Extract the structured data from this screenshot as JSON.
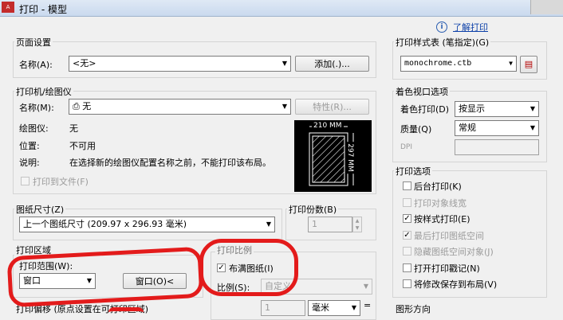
{
  "window": {
    "logo": "A",
    "title": "打印 - 模型"
  },
  "help": {
    "link": "了解打印"
  },
  "page_setup": {
    "title": "页面设置",
    "name_label": "名称(A):",
    "name_value": "<无>",
    "add_button": "添加(.)..."
  },
  "printer": {
    "title": "打印机/绘图仪",
    "name_label": "名称(M):",
    "name_value": "无",
    "properties_button": "特性(R)...",
    "plotter_label": "绘图仪:",
    "plotter_value": "无",
    "location_label": "位置:",
    "location_value": "不可用",
    "description_label": "说明:",
    "description_value": "在选择新的绘图仪配置名称之前，不能打印该布局。",
    "print_to_file": "打印到文件(F)",
    "preview_width": "210 MM",
    "preview_height": "297 MM"
  },
  "paper_size": {
    "title": "图纸尺寸(Z)",
    "value": "上一个图纸尺寸 (209.97 x 296.93 毫米)"
  },
  "copies": {
    "title": "打印份数(B)",
    "value": "1"
  },
  "print_area": {
    "title": "打印区域",
    "range_label": "打印范围(W):",
    "range_value": "窗口",
    "window_button": "窗口(O)<"
  },
  "print_scale": {
    "title": "打印比例",
    "fit_paper": "布满图纸(I)",
    "fit_checked": true,
    "scale_label": "比例(S):",
    "scale_value": "自定义",
    "value1": "1",
    "unit": "毫米",
    "equals": "="
  },
  "print_offset": {
    "title": "打印偏移 (原点设置在可打印区域)"
  },
  "plot_style": {
    "title": "打印样式表 (笔指定)(G)",
    "value": "monochrome.ctb"
  },
  "shaded_viewport": {
    "title": "着色视口选项",
    "shade_label": "着色打印(D)",
    "shade_value": "按显示",
    "quality_label": "质量(Q)",
    "quality_value": "常规",
    "dpi_label": "DPI"
  },
  "plot_options": {
    "title": "打印选项",
    "items": [
      {
        "label": "后台打印(K)",
        "checked": false,
        "disabled": false
      },
      {
        "label": "打印对象线宽",
        "checked": false,
        "disabled": true
      },
      {
        "label": "按样式打印(E)",
        "checked": true,
        "disabled": false
      },
      {
        "label": "最后打印图纸空间",
        "checked": true,
        "disabled": true
      },
      {
        "label": "隐藏图纸空间对象(J)",
        "checked": false,
        "disabled": true
      },
      {
        "label": "打开打印戳记(N)",
        "checked": false,
        "disabled": false
      },
      {
        "label": "将修改保存到布局(V)",
        "checked": false,
        "disabled": false
      }
    ]
  },
  "orientation": {
    "title": "图形方向"
  }
}
